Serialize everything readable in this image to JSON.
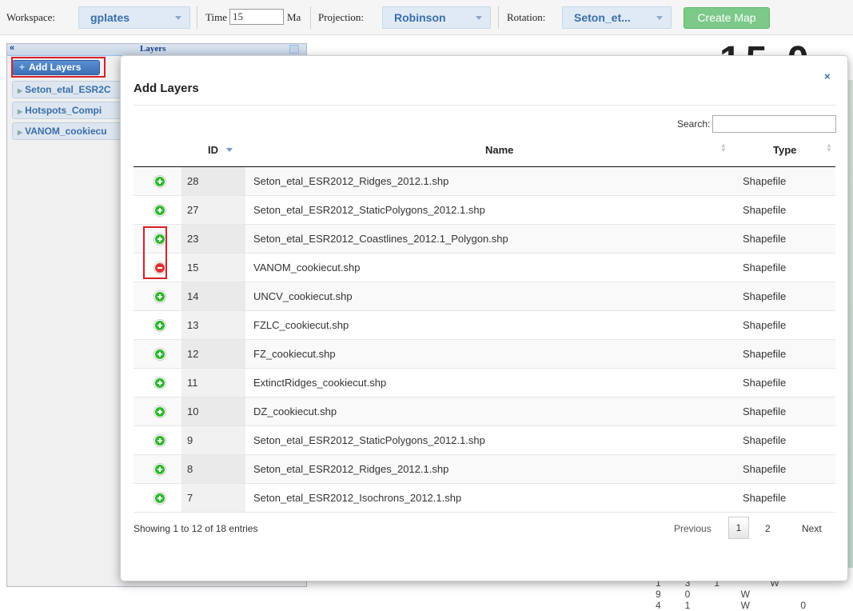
{
  "toolbar": {
    "workspace_label": "Workspace:",
    "workspace_value": "gplates",
    "time_label": "Time",
    "time_value": "15",
    "time_unit": "Ma",
    "projection_label": "Projection:",
    "projection_value": "Robinson",
    "rotation_label": "Rotation:",
    "rotation_value": "Seton_et...",
    "create_map_label": "Create Map",
    "create_map_color": "#7cc98a"
  },
  "sidebar": {
    "title": "Layers",
    "collapse_icon": "«",
    "add_layers_label": "Add Layers",
    "items": [
      {
        "label": "Seton_etal_ESR2C"
      },
      {
        "label": "Hotspots_Compi"
      },
      {
        "label": "VANOM_cookiecu"
      }
    ]
  },
  "map": {
    "big_digits": "15 0",
    "bottom_labels": "131 W 90 W 41 W 0"
  },
  "modal": {
    "title": "Add Layers",
    "close_icon": "×",
    "search_label": "Search:",
    "search_value": "",
    "columns": {
      "id": "ID",
      "name": "Name",
      "type": "Type"
    },
    "rows": [
      {
        "action": "add",
        "id": "28",
        "name": "Seton_etal_ESR2012_Ridges_2012.1.shp",
        "type": "Shapefile"
      },
      {
        "action": "add",
        "id": "27",
        "name": "Seton_etal_ESR2012_StaticPolygons_2012.1.shp",
        "type": "Shapefile"
      },
      {
        "action": "add",
        "id": "23",
        "name": "Seton_etal_ESR2012_Coastlines_2012.1_Polygon.shp",
        "type": "Shapefile"
      },
      {
        "action": "remove",
        "id": "15",
        "name": "VANOM_cookiecut.shp",
        "type": "Shapefile"
      },
      {
        "action": "add",
        "id": "14",
        "name": "UNCV_cookiecut.shp",
        "type": "Shapefile"
      },
      {
        "action": "add",
        "id": "13",
        "name": "FZLC_cookiecut.shp",
        "type": "Shapefile"
      },
      {
        "action": "add",
        "id": "12",
        "name": "FZ_cookiecut.shp",
        "type": "Shapefile"
      },
      {
        "action": "add",
        "id": "11",
        "name": "ExtinctRidges_cookiecut.shp",
        "type": "Shapefile"
      },
      {
        "action": "add",
        "id": "10",
        "name": "DZ_cookiecut.shp",
        "type": "Shapefile"
      },
      {
        "action": "add",
        "id": "9",
        "name": "Seton_etal_ESR2012_StaticPolygons_2012.1.shp",
        "type": "Shapefile"
      },
      {
        "action": "add",
        "id": "8",
        "name": "Seton_etal_ESR2012_Ridges_2012.1.shp",
        "type": "Shapefile"
      },
      {
        "action": "add",
        "id": "7",
        "name": "Seton_etal_ESR2012_Isochrons_2012.1.shp",
        "type": "Shapefile"
      }
    ],
    "info": "Showing 1 to 12 of 18 entries",
    "pagination": {
      "previous": "Previous",
      "page1": "1",
      "page2": "2",
      "next": "Next"
    },
    "colors": {
      "add": "#2eb82e",
      "remove": "#dd3333",
      "highlight": "#d6202a"
    }
  }
}
